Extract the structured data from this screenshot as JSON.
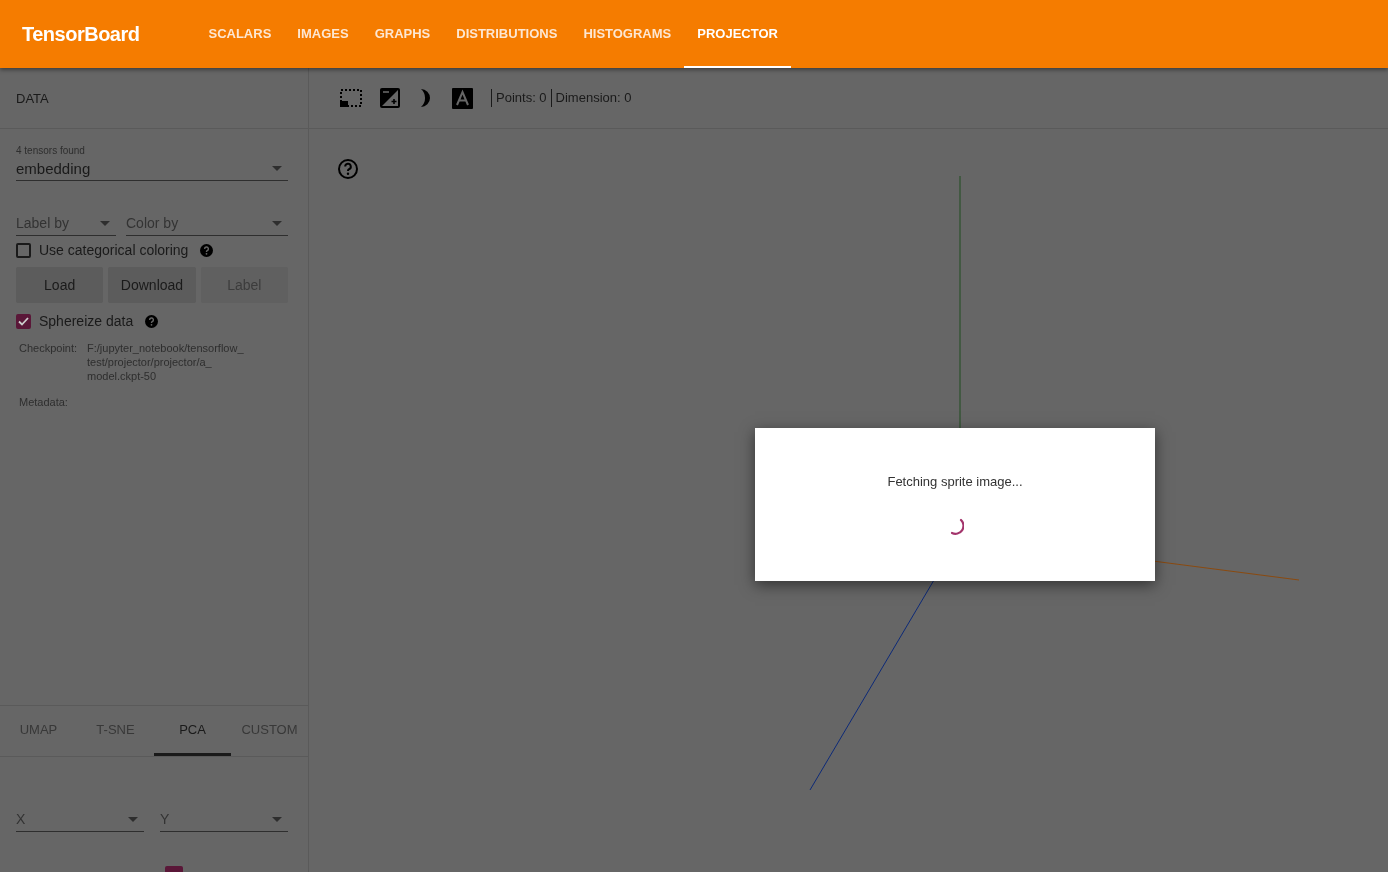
{
  "header": {
    "title": "TensorBoard",
    "tabs": [
      {
        "label": "SCALARS",
        "selected": false
      },
      {
        "label": "IMAGES",
        "selected": false
      },
      {
        "label": "GRAPHS",
        "selected": false
      },
      {
        "label": "DISTRIBUTIONS",
        "selected": false
      },
      {
        "label": "HISTOGRAMS",
        "selected": false
      },
      {
        "label": "PROJECTOR",
        "selected": true
      }
    ]
  },
  "sidebar": {
    "heading": "DATA",
    "tensor_count": "4 tensors found",
    "tensor": "embedding",
    "label_by": {
      "placeholder": "Label by"
    },
    "color_by": {
      "placeholder": "Color by"
    },
    "categorical": {
      "label": "Use categorical coloring",
      "checked": false
    },
    "buttons": [
      {
        "label": "Load",
        "disabled": false
      },
      {
        "label": "Download",
        "disabled": false
      },
      {
        "label": "Label",
        "disabled": true
      }
    ],
    "sphereize": {
      "label": "Sphereize data",
      "checked": true
    },
    "info": [
      {
        "key": "Checkpoint:",
        "value": "F:/jupyter_notebook/tensorflow_ test/projector/projector/a_ model.ckpt-50"
      },
      {
        "key": "Metadata:"
      }
    ],
    "projection_tabs": [
      {
        "label": "UMAP",
        "selected": false
      },
      {
        "label": "T-SNE",
        "selected": false
      },
      {
        "label": "PCA",
        "selected": true
      },
      {
        "label": "CUSTOM",
        "selected": false
      }
    ],
    "x_axis": {
      "placeholder": "X"
    },
    "y_axis": {
      "placeholder": "Y"
    },
    "partial_checkbox": {
      "checked": true
    }
  },
  "toolbar": {
    "points": "Points: 0",
    "dimension": "Dimension: 0"
  },
  "dialog": {
    "message": "Fetching sprite image..."
  }
}
